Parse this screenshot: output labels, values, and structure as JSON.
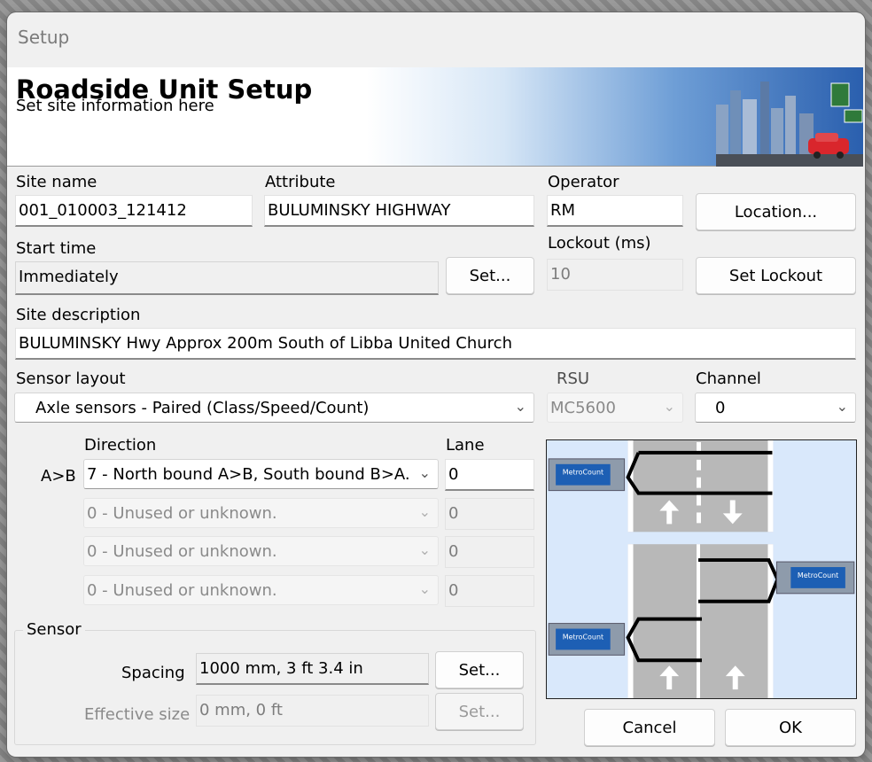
{
  "window": {
    "title": "Setup"
  },
  "banner": {
    "title": "Roadside Unit Setup",
    "subtitle": "Set site information here"
  },
  "site": {
    "name_label": "Site name",
    "name_value": "001_010003_121412",
    "attribute_label": "Attribute",
    "attribute_value": "BULUMINSKY HIGHWAY",
    "operator_label": "Operator",
    "operator_value": "RM",
    "location_button": "Location...",
    "start_time_label": "Start time",
    "start_time_value": "Immediately",
    "start_set_button": "Set...",
    "lockout_label": "Lockout (ms)",
    "lockout_value": "10",
    "set_lockout_button": "Set Lockout",
    "description_label": "Site description",
    "description_value": "BULUMINSKY Hwy Approx 200m South of Libba United Church"
  },
  "sensor_layout": {
    "label": "Sensor layout",
    "value": "Axle sensors - Paired (Class/Speed/Count)",
    "rsu_label": "RSU",
    "rsu_value": "MC5600",
    "channel_label": "Channel",
    "channel_value": "0"
  },
  "direction": {
    "direction_header": "Direction",
    "lane_header": "Lane",
    "row_label": "A>B",
    "rows": [
      {
        "direction": "7 - North bound A>B, South bound B>A.",
        "lane": "0",
        "enabled": true
      },
      {
        "direction": "0 - Unused or unknown.",
        "lane": "0",
        "enabled": false
      },
      {
        "direction": "0 - Unused or unknown.",
        "lane": "0",
        "enabled": false
      },
      {
        "direction": "0 - Unused or unknown.",
        "lane": "0",
        "enabled": false
      }
    ]
  },
  "sensor": {
    "group_label": "Sensor",
    "spacing_label": "Spacing",
    "spacing_value": "1000 mm, 3 ft 3.4 in",
    "spacing_set": "Set...",
    "effective_label": "Effective size",
    "effective_value": "0 mm, 0 ft",
    "effective_set": "Set..."
  },
  "diagram": {
    "device_brand": "MetroCount"
  },
  "actions": {
    "cancel": "Cancel",
    "ok": "OK"
  },
  "colors": {
    "banner_blue": "#2a5fae",
    "road_gray": "#b8b8b8",
    "diagram_bg": "#d9e8fb",
    "device_blue": "#1d5fb4"
  }
}
